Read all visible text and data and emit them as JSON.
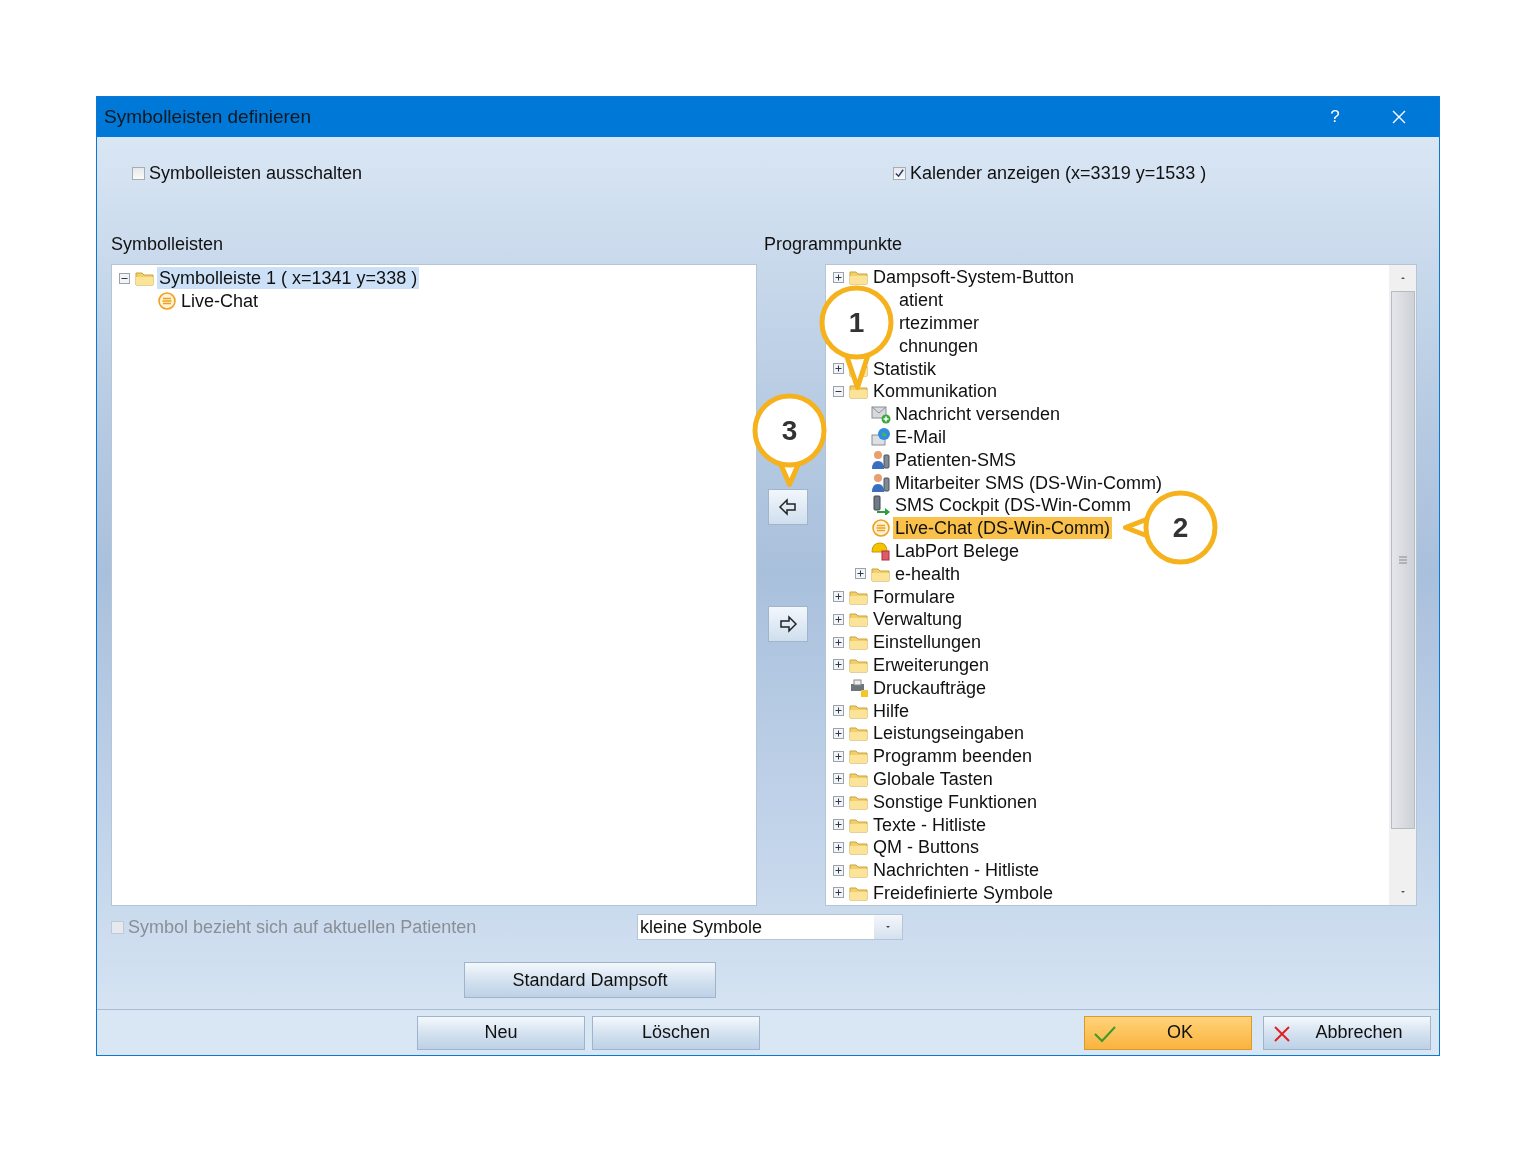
{
  "window": {
    "title": "Symbolleisten definieren",
    "help": "?"
  },
  "options": [
    {
      "label": "Symbolleisten ausschalten",
      "checked": false
    },
    {
      "label": "Kalender anzeigen (x=3319 y=1533 )",
      "checked": true
    }
  ],
  "toolbars": {
    "heading": "Symbolleisten",
    "tree": [
      {
        "label": "Symbolleiste 1 ( x=1341 y=338 )",
        "kind": "folder",
        "expanded": true,
        "selected": true,
        "children": [
          {
            "label": "Live-Chat",
            "kind": "chat",
            "selected": false
          }
        ]
      }
    ]
  },
  "program_items": {
    "heading": "Programmpunkte",
    "tree": [
      {
        "label": "Dampsoft-System-Button",
        "kind": "folder",
        "expanded": false,
        "selected": false
      },
      {
        "label": "atient",
        "kind": "covered",
        "selected": false
      },
      {
        "label": "rtezimmer",
        "kind": "covered",
        "selected": false
      },
      {
        "label": "chnungen",
        "kind": "covered",
        "selected": false
      },
      {
        "label": "Statistik",
        "kind": "folder",
        "expanded": false,
        "selected": false
      },
      {
        "label": "Kommunikation",
        "kind": "folder",
        "expanded": true,
        "selected": false,
        "children": [
          {
            "label": "Nachricht versenden",
            "kind": "message",
            "selected": false
          },
          {
            "label": "E-Mail",
            "kind": "email",
            "selected": false
          },
          {
            "label": "Patienten-SMS",
            "kind": "sms",
            "selected": false
          },
          {
            "label": "Mitarbeiter SMS (DS-Win-Comm)",
            "kind": "sms",
            "selected": false
          },
          {
            "label": "SMS Cockpit (DS-Win-Comm",
            "kind": "cockpit",
            "selected": false
          },
          {
            "label": "Live-Chat (DS-Win-Comm)",
            "kind": "chat",
            "selected": true
          },
          {
            "label": "LabPort Belege",
            "kind": "lab",
            "selected": false
          },
          {
            "label": "e-health",
            "kind": "folder",
            "expanded": false,
            "selected": false
          }
        ]
      },
      {
        "label": "Formulare",
        "kind": "folder",
        "expanded": false,
        "selected": false
      },
      {
        "label": "Verwaltung",
        "kind": "folder",
        "expanded": false,
        "selected": false
      },
      {
        "label": "Einstellungen",
        "kind": "folder",
        "expanded": false,
        "selected": false
      },
      {
        "label": "Erweiterungen",
        "kind": "folder",
        "expanded": false,
        "selected": false
      },
      {
        "label": "Druckaufträge",
        "kind": "printer",
        "selected": false
      },
      {
        "label": "Hilfe",
        "kind": "folder",
        "expanded": false,
        "selected": false
      },
      {
        "label": "Leistungseingaben",
        "kind": "folder",
        "expanded": false,
        "selected": false
      },
      {
        "label": "Programm beenden",
        "kind": "folder",
        "expanded": false,
        "selected": false
      },
      {
        "label": "Globale Tasten",
        "kind": "folder",
        "expanded": false,
        "selected": false
      },
      {
        "label": "Sonstige Funktionen",
        "kind": "folder",
        "expanded": false,
        "selected": false
      },
      {
        "label": "Texte - Hitliste",
        "kind": "folder",
        "expanded": false,
        "selected": false
      },
      {
        "label": "QM - Buttons",
        "kind": "folder",
        "expanded": false,
        "selected": false
      },
      {
        "label": "Nachrichten - Hitliste",
        "kind": "folder",
        "expanded": false,
        "selected": false
      },
      {
        "label": "Freidefinierte Symbole",
        "kind": "folder",
        "expanded": false,
        "selected": false
      }
    ]
  },
  "patient_option": {
    "label": "Symbol bezieht sich auf aktuellen Patienten",
    "checked": false,
    "disabled": true
  },
  "size_select": {
    "value": "kleine Symbole"
  },
  "reset_button": "Standard Dampsoft",
  "footer_buttons": [
    {
      "label": "Neu",
      "kind": "plain"
    },
    {
      "label": "Löschen",
      "kind": "plain"
    },
    {
      "label": "OK",
      "kind": "confirm"
    },
    {
      "label": "Abbrechen",
      "kind": "cancel"
    }
  ],
  "callouts": [
    {
      "label": "1"
    },
    {
      "label": "2"
    },
    {
      "label": "3"
    }
  ]
}
